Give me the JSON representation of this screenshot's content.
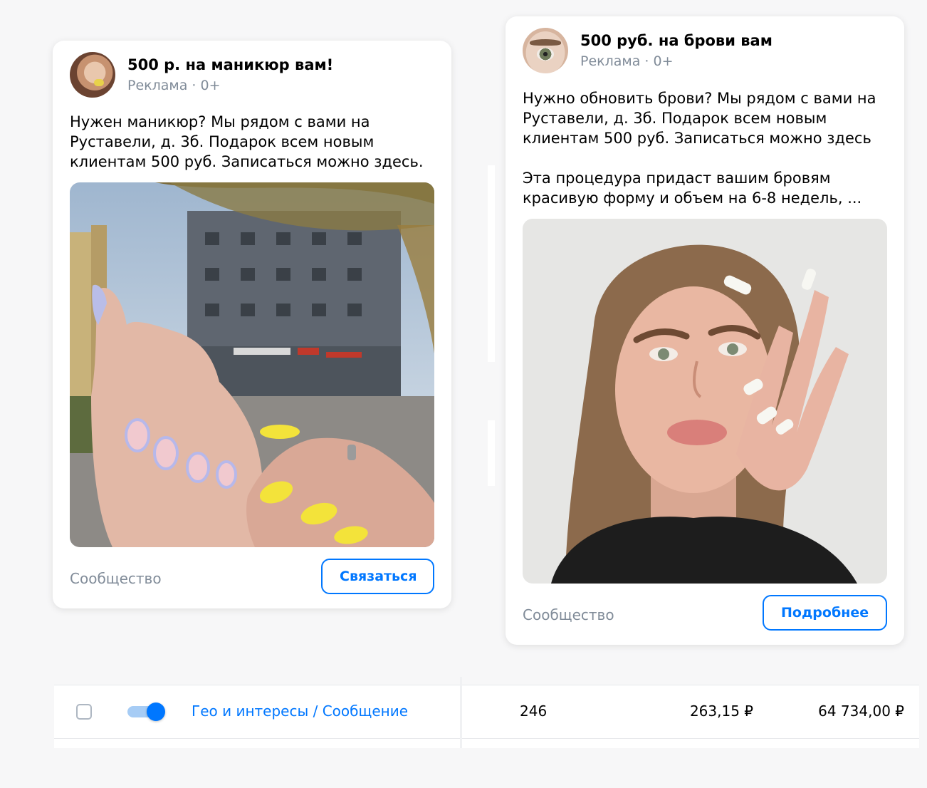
{
  "ads": [
    {
      "title": "500 р. на маникюр вам!",
      "meta": "Реклама · 0+",
      "text": [
        "Нужен маникюр? Мы рядом с вами на Руставели, д. 3б. Подарок всем новым клиентам 500 руб. Записаться можно здесь."
      ],
      "footer_label": "Сообщество",
      "cta": "Связаться"
    },
    {
      "title": "500 руб. на брови вам",
      "meta": "Реклама · 0+",
      "text": [
        "Нужно обновить брови? Мы рядом с вами на Руставели, д. 3б. Подарок всем новым клиентам 500 руб. Записаться можно здесь",
        "Эта процедура придаст вашим бровям красивую форму и объем на 6-8 недель, ..."
      ],
      "footer_label": "Сообщество",
      "cta": "Подробнее"
    }
  ],
  "table_row": {
    "checked": false,
    "toggle_on": true,
    "name": "Гео и интересы / Сообщение",
    "value_1": "246",
    "value_2": "263,15 ₽",
    "value_3": "64 734,00 ₽"
  },
  "colors": {
    "accent": "#0077ff",
    "secondary_text": "#818c99",
    "background": "#f7f7f8"
  },
  "icons": [
    "checkbox-icon",
    "toggle-switch"
  ]
}
